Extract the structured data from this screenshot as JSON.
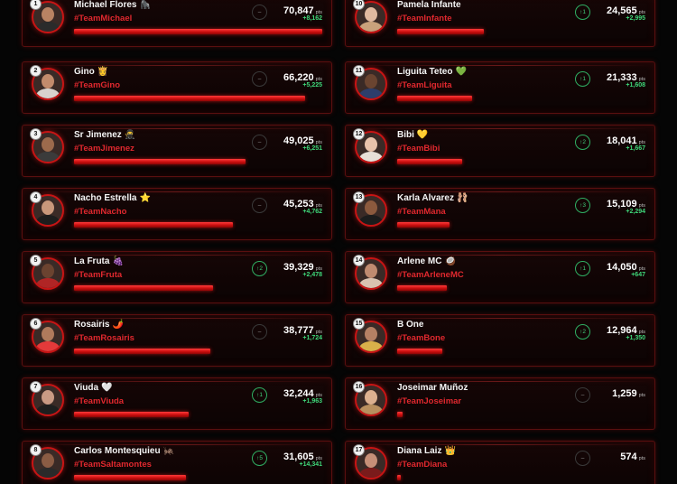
{
  "leaderboard": {
    "entries": [
      {
        "rank": "1",
        "name": "Michael Flores",
        "emoji": "🦍",
        "team": "#TeamMichael",
        "score": "70,847",
        "unit": "pts",
        "delta": "+8,162",
        "trend": "–",
        "trend_dir": "neutral",
        "bar_fraction": 1.0,
        "skin": "#b98363",
        "shirt": "#2b2b2b"
      },
      {
        "rank": "2",
        "name": "Gino",
        "emoji": "👸",
        "team": "#TeamGino",
        "score": "66,220",
        "unit": "pts",
        "delta": "+5,225",
        "trend": "–",
        "trend_dir": "neutral",
        "bar_fraction": 0.93,
        "skin": "#c28b6c",
        "shirt": "#d8d2cd"
      },
      {
        "rank": "3",
        "name": "Sr Jimenez",
        "emoji": "🥷",
        "team": "#TeamJimenez",
        "score": "49,025",
        "unit": "pts",
        "delta": "+6,251",
        "trend": "–",
        "trend_dir": "neutral",
        "bar_fraction": 0.69,
        "skin": "#9c6a4c",
        "shirt": "#3b3b3b"
      },
      {
        "rank": "4",
        "name": "Nacho Estrella",
        "emoji": "⭐",
        "team": "#TeamNacho",
        "score": "45,253",
        "unit": "pts",
        "delta": "+4,762",
        "trend": "–",
        "trend_dir": "neutral",
        "bar_fraction": 0.64,
        "skin": "#c9987b",
        "shirt": "#1d1d1d"
      },
      {
        "rank": "5",
        "name": "La Fruta",
        "emoji": "🍇",
        "team": "#TeamFruta",
        "score": "39,329",
        "unit": "pts",
        "delta": "+2,478",
        "trend": "↑2",
        "trend_dir": "up",
        "bar_fraction": 0.56,
        "skin": "#6b4330",
        "shirt": "#b02525"
      },
      {
        "rank": "6",
        "name": "Rosairis",
        "emoji": "🌶️",
        "team": "#TeamRosairis",
        "score": "38,777",
        "unit": "pts",
        "delta": "+1,724",
        "trend": "–",
        "trend_dir": "neutral",
        "bar_fraction": 0.55,
        "skin": "#b07a5c",
        "shirt": "#e43a3a"
      },
      {
        "rank": "7",
        "name": "Viuda",
        "emoji": "🤍",
        "team": "#TeamViuda",
        "score": "32,244",
        "unit": "pts",
        "delta": "+1,963",
        "trend": "↑1",
        "trend_dir": "up",
        "bar_fraction": 0.46,
        "skin": "#c99a84",
        "shirt": "#1e1e1e"
      },
      {
        "rank": "8",
        "name": "Carlos Montesquieu",
        "emoji": "🦗",
        "team": "#TeamSaltamontes",
        "score": "31,605",
        "unit": "pts",
        "delta": "+14,341",
        "trend": "↑5",
        "trend_dir": "up",
        "bar_fraction": 0.45,
        "skin": "#8a5c44",
        "shirt": "#2a2a2a"
      },
      {
        "rank": "10",
        "name": "Pamela Infante",
        "emoji": "",
        "team": "#TeamInfante",
        "score": "24,565",
        "unit": "pts",
        "delta": "+2,995",
        "trend": "↑1",
        "trend_dir": "up",
        "bar_fraction": 0.35,
        "skin": "#e0b99f",
        "shirt": "#c9a27c"
      },
      {
        "rank": "11",
        "name": "Liguita Teteo",
        "emoji": "💚",
        "team": "#TeamLiguita",
        "score": "21,333",
        "unit": "pts",
        "delta": "+1,608",
        "trend": "↑1",
        "trend_dir": "up",
        "bar_fraction": 0.3,
        "skin": "#6a4430",
        "shirt": "#2c3e6b"
      },
      {
        "rank": "12",
        "name": "Bibi",
        "emoji": "💛",
        "team": "#TeamBibi",
        "score": "18,041",
        "unit": "pts",
        "delta": "+1,667",
        "trend": "↑2",
        "trend_dir": "up",
        "bar_fraction": 0.26,
        "skin": "#e8c2aa",
        "shirt": "#e8e0d8"
      },
      {
        "rank": "13",
        "name": "Karla Alvarez",
        "emoji": "🩰",
        "team": "#TeamMana",
        "score": "15,109",
        "unit": "pts",
        "delta": "+2,294",
        "trend": "↑3",
        "trend_dir": "up",
        "bar_fraction": 0.21,
        "skin": "#8c5a3e",
        "shirt": "#1c1c1c"
      },
      {
        "rank": "14",
        "name": "Arlene MC",
        "emoji": "🥥",
        "team": "#TeamArleneMC",
        "score": "14,050",
        "unit": "pts",
        "delta": "+647",
        "trend": "↑1",
        "trend_dir": "up",
        "bar_fraction": 0.2,
        "skin": "#c08b70",
        "shirt": "#d9c2b0"
      },
      {
        "rank": "15",
        "name": "B One",
        "emoji": "",
        "team": "#TeamBone",
        "score": "12,964",
        "unit": "pts",
        "delta": "+1,350",
        "trend": "↑2",
        "trend_dir": "up",
        "bar_fraction": 0.18,
        "skin": "#b58064",
        "shirt": "#d9b04a"
      },
      {
        "rank": "16",
        "name": "Joseimar Muñoz",
        "emoji": "",
        "team": "#TeamJoseimar",
        "score": "1,259",
        "unit": "pts",
        "delta": "",
        "trend": "–",
        "trend_dir": "neutral",
        "bar_fraction": 0.02,
        "skin": "#dcb08f",
        "shirt": "#b9905f"
      },
      {
        "rank": "17",
        "name": "Diana Laiz",
        "emoji": "👑",
        "team": "#TeamDiana",
        "score": "574",
        "unit": "pts",
        "delta": "",
        "trend": "–",
        "trend_dir": "neutral",
        "bar_fraction": 0.01,
        "skin": "#c69078",
        "shirt": "#7a1b1b"
      }
    ]
  }
}
